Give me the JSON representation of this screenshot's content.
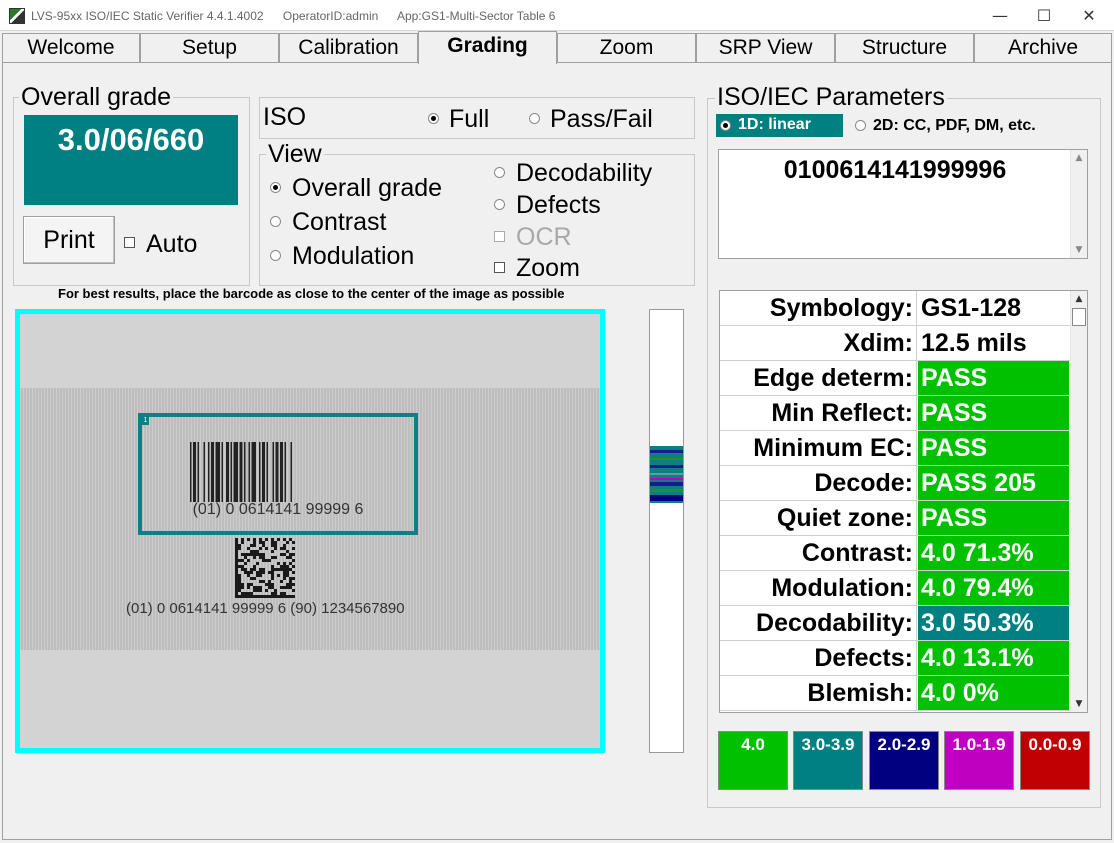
{
  "window": {
    "title": "LVS-95xx ISO/IEC Static Verifier 4.4.1.4002",
    "operator": "OperatorID:admin",
    "app": "App:GS1-Multi-Sector Table 6",
    "minimize": "—",
    "maximize": "☐",
    "close": "✕"
  },
  "tabs": [
    {
      "label": "Welcome"
    },
    {
      "label": "Setup"
    },
    {
      "label": "Calibration"
    },
    {
      "label": "Grading"
    },
    {
      "label": "Zoom"
    },
    {
      "label": "SRP View"
    },
    {
      "label": "Structure"
    },
    {
      "label": "Archive"
    }
  ],
  "active_tab": "Grading",
  "overall": {
    "group_label": "Overall grade",
    "grade": "3.0/06/660",
    "print_label": "Print",
    "auto_label": "Auto",
    "auto_checked": false
  },
  "iso": {
    "label": "ISO",
    "full_label": "Full",
    "passfail_label": "Pass/Fail",
    "selected": "Full"
  },
  "view": {
    "group_label": "View",
    "options": {
      "overall": "Overall grade",
      "contrast": "Contrast",
      "modulation": "Modulation",
      "decodability": "Decodability",
      "defects": "Defects",
      "ocr": "OCR",
      "zoom": "Zoom"
    },
    "selected": "Overall grade"
  },
  "hint": "For best results, place the barcode as close to the center of the image as possible",
  "image": {
    "roi_tag": "1",
    "barcode1_text": "(01) 0 0614141 99999 6",
    "barcode2_text": "(01) 0 0614141 99999 6 (90) 1234567890"
  },
  "params": {
    "group_label": "ISO/IEC Parameters",
    "mode_1d": "1D: linear",
    "mode_2d": "2D: CC, PDF, DM, etc.",
    "decoded": "0100614141999996",
    "rows": [
      {
        "name": "Symbology:",
        "value": "GS1-128",
        "grade": "plain"
      },
      {
        "name": "Xdim:",
        "value": "12.5 mils",
        "grade": "plain"
      },
      {
        "name": "Edge determ:",
        "value": "PASS",
        "grade": "g4"
      },
      {
        "name": "Min Reflect:",
        "value": "PASS",
        "grade": "g4"
      },
      {
        "name": "Minimum EC:",
        "value": "PASS",
        "grade": "g4"
      },
      {
        "name": "Decode:",
        "value": "PASS 205",
        "grade": "g4"
      },
      {
        "name": "Quiet zone:",
        "value": "PASS",
        "grade": "g4"
      },
      {
        "name": "Contrast:",
        "value": "4.0  71.3%",
        "grade": "g4"
      },
      {
        "name": "Modulation:",
        "value": "4.0  79.4%",
        "grade": "g4"
      },
      {
        "name": "Decodability:",
        "value": "3.0  50.3%",
        "grade": "g3"
      },
      {
        "name": "Defects:",
        "value": "4.0  13.1%",
        "grade": "g4"
      },
      {
        "name": "Blemish:",
        "value": "4.0  0%",
        "grade": "g4"
      }
    ]
  },
  "legend": [
    {
      "label": "4.0",
      "color": "#00c000"
    },
    {
      "label": "3.0-3.9",
      "color": "#008080"
    },
    {
      "label": "2.0-2.9",
      "color": "#000080"
    },
    {
      "label": "1.0-1.9",
      "color": "#c000c0"
    },
    {
      "label": "0.0-0.9",
      "color": "#c00000"
    }
  ],
  "colors": {
    "accent_cyan": "#00ffff",
    "grade_teal": "#008080",
    "pass_green": "#00c000"
  }
}
